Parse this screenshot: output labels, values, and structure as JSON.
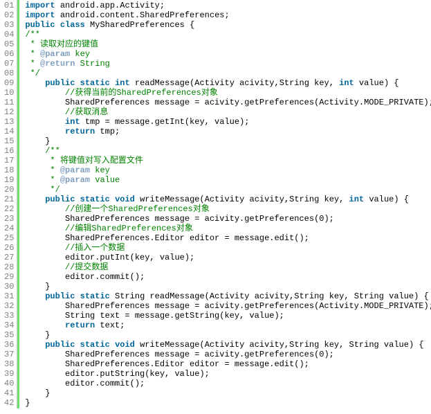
{
  "lines": [
    {
      "num": "01",
      "tokens": [
        [
          "kw",
          "import"
        ],
        [
          "plain",
          " android.app.Activity;"
        ]
      ]
    },
    {
      "num": "02",
      "tokens": [
        [
          "kw",
          "import"
        ],
        [
          "plain",
          " android.content.SharedPreferences;"
        ]
      ]
    },
    {
      "num": "03",
      "tokens": [
        [
          "kw",
          "public"
        ],
        [
          "plain",
          " "
        ],
        [
          "kw",
          "class"
        ],
        [
          "plain",
          " MySharedPreferences {"
        ]
      ]
    },
    {
      "num": "04",
      "tokens": [
        [
          "doc",
          "/**"
        ]
      ]
    },
    {
      "num": "05",
      "tokens": [
        [
          "doc",
          " * 读取对应的键值"
        ]
      ]
    },
    {
      "num": "06",
      "tokens": [
        [
          "doc",
          " * "
        ],
        [
          "tag",
          "@param"
        ],
        [
          "doc",
          " key"
        ]
      ]
    },
    {
      "num": "07",
      "tokens": [
        [
          "doc",
          " * "
        ],
        [
          "tag",
          "@return"
        ],
        [
          "doc",
          " String"
        ]
      ]
    },
    {
      "num": "08",
      "tokens": [
        [
          "doc",
          " */"
        ]
      ]
    },
    {
      "num": "09",
      "tokens": [
        [
          "plain",
          "    "
        ],
        [
          "kw",
          "public"
        ],
        [
          "plain",
          " "
        ],
        [
          "kw",
          "static"
        ],
        [
          "plain",
          " "
        ],
        [
          "kw",
          "int"
        ],
        [
          "plain",
          " readMessage(Activity acivity,String key, "
        ],
        [
          "kw",
          "int"
        ],
        [
          "plain",
          " value) {"
        ]
      ]
    },
    {
      "num": "10",
      "tokens": [
        [
          "plain",
          "        "
        ],
        [
          "cmt",
          "//获得当前的SharedPreferences对象"
        ]
      ]
    },
    {
      "num": "11",
      "tokens": [
        [
          "plain",
          "        SharedPreferences message = acivity.getPreferences(Activity.MODE_PRIVATE);"
        ]
      ]
    },
    {
      "num": "12",
      "tokens": [
        [
          "plain",
          "        "
        ],
        [
          "cmt",
          "//获取消息"
        ]
      ]
    },
    {
      "num": "13",
      "tokens": [
        [
          "plain",
          "        "
        ],
        [
          "kw",
          "int"
        ],
        [
          "plain",
          " tmp = message.getInt(key, value);"
        ]
      ]
    },
    {
      "num": "14",
      "tokens": [
        [
          "plain",
          "        "
        ],
        [
          "kw",
          "return"
        ],
        [
          "plain",
          " tmp;"
        ]
      ]
    },
    {
      "num": "15",
      "tokens": [
        [
          "plain",
          "    }"
        ]
      ]
    },
    {
      "num": "16",
      "tokens": [
        [
          "plain",
          "    "
        ],
        [
          "doc",
          "/**"
        ]
      ]
    },
    {
      "num": "17",
      "tokens": [
        [
          "plain",
          "    "
        ],
        [
          "doc",
          " * 将键值对写入配置文件"
        ]
      ]
    },
    {
      "num": "18",
      "tokens": [
        [
          "plain",
          "    "
        ],
        [
          "doc",
          " * "
        ],
        [
          "tag",
          "@param"
        ],
        [
          "doc",
          " key"
        ]
      ]
    },
    {
      "num": "19",
      "tokens": [
        [
          "plain",
          "    "
        ],
        [
          "doc",
          " * "
        ],
        [
          "tag",
          "@param"
        ],
        [
          "doc",
          " value"
        ]
      ]
    },
    {
      "num": "20",
      "tokens": [
        [
          "plain",
          "    "
        ],
        [
          "doc",
          " */"
        ]
      ]
    },
    {
      "num": "21",
      "tokens": [
        [
          "plain",
          "    "
        ],
        [
          "kw",
          "public"
        ],
        [
          "plain",
          " "
        ],
        [
          "kw",
          "static"
        ],
        [
          "plain",
          " "
        ],
        [
          "kw",
          "void"
        ],
        [
          "plain",
          " writeMessage(Activity acivity,String key, "
        ],
        [
          "kw",
          "int"
        ],
        [
          "plain",
          " value) {"
        ]
      ]
    },
    {
      "num": "22",
      "tokens": [
        [
          "plain",
          "        "
        ],
        [
          "cmt",
          "//创建一个SharedPreferences对象"
        ]
      ]
    },
    {
      "num": "23",
      "tokens": [
        [
          "plain",
          "        SharedPreferences message = acivity.getPreferences("
        ],
        [
          "plain",
          "0"
        ],
        [
          "plain",
          ");"
        ]
      ]
    },
    {
      "num": "24",
      "tokens": [
        [
          "plain",
          "        "
        ],
        [
          "cmt",
          "//编辑SharedPreferences对象"
        ]
      ]
    },
    {
      "num": "25",
      "tokens": [
        [
          "plain",
          "        SharedPreferences.Editor editor = message.edit();"
        ]
      ]
    },
    {
      "num": "26",
      "tokens": [
        [
          "plain",
          "        "
        ],
        [
          "cmt",
          "//插入一个数据"
        ]
      ]
    },
    {
      "num": "27",
      "tokens": [
        [
          "plain",
          "        editor.putInt(key, value);"
        ]
      ]
    },
    {
      "num": "28",
      "tokens": [
        [
          "plain",
          "        "
        ],
        [
          "cmt",
          "//提交数据"
        ]
      ]
    },
    {
      "num": "29",
      "tokens": [
        [
          "plain",
          "        editor.commit();"
        ]
      ]
    },
    {
      "num": "30",
      "tokens": [
        [
          "plain",
          "    }"
        ]
      ]
    },
    {
      "num": "31",
      "tokens": [
        [
          "plain",
          "    "
        ],
        [
          "kw",
          "public"
        ],
        [
          "plain",
          " "
        ],
        [
          "kw",
          "static"
        ],
        [
          "plain",
          " String readMessage(Activity acivity,String key, String value) {"
        ]
      ]
    },
    {
      "num": "32",
      "tokens": [
        [
          "plain",
          "        SharedPreferences message = acivity.getPreferences(Activity.MODE_PRIVATE);"
        ]
      ]
    },
    {
      "num": "33",
      "tokens": [
        [
          "plain",
          "        String text = message.getString(key, value);"
        ]
      ]
    },
    {
      "num": "34",
      "tokens": [
        [
          "plain",
          "        "
        ],
        [
          "kw",
          "return"
        ],
        [
          "plain",
          " text;"
        ]
      ]
    },
    {
      "num": "35",
      "tokens": [
        [
          "plain",
          "    }"
        ]
      ]
    },
    {
      "num": "36",
      "tokens": [
        [
          "plain",
          "    "
        ],
        [
          "kw",
          "public"
        ],
        [
          "plain",
          " "
        ],
        [
          "kw",
          "static"
        ],
        [
          "plain",
          " "
        ],
        [
          "kw",
          "void"
        ],
        [
          "plain",
          " writeMessage(Activity acivity,String key, String value) {"
        ]
      ]
    },
    {
      "num": "37",
      "tokens": [
        [
          "plain",
          "        SharedPreferences message = acivity.getPreferences("
        ],
        [
          "plain",
          "0"
        ],
        [
          "plain",
          ");"
        ]
      ]
    },
    {
      "num": "38",
      "tokens": [
        [
          "plain",
          "        SharedPreferences.Editor editor = message.edit();"
        ]
      ]
    },
    {
      "num": "39",
      "tokens": [
        [
          "plain",
          "        editor.putString(key, value);"
        ]
      ]
    },
    {
      "num": "40",
      "tokens": [
        [
          "plain",
          "        editor.commit();"
        ]
      ]
    },
    {
      "num": "41",
      "tokens": [
        [
          "plain",
          "    }"
        ]
      ]
    },
    {
      "num": "42",
      "tokens": [
        [
          "plain",
          "}"
        ]
      ]
    }
  ]
}
